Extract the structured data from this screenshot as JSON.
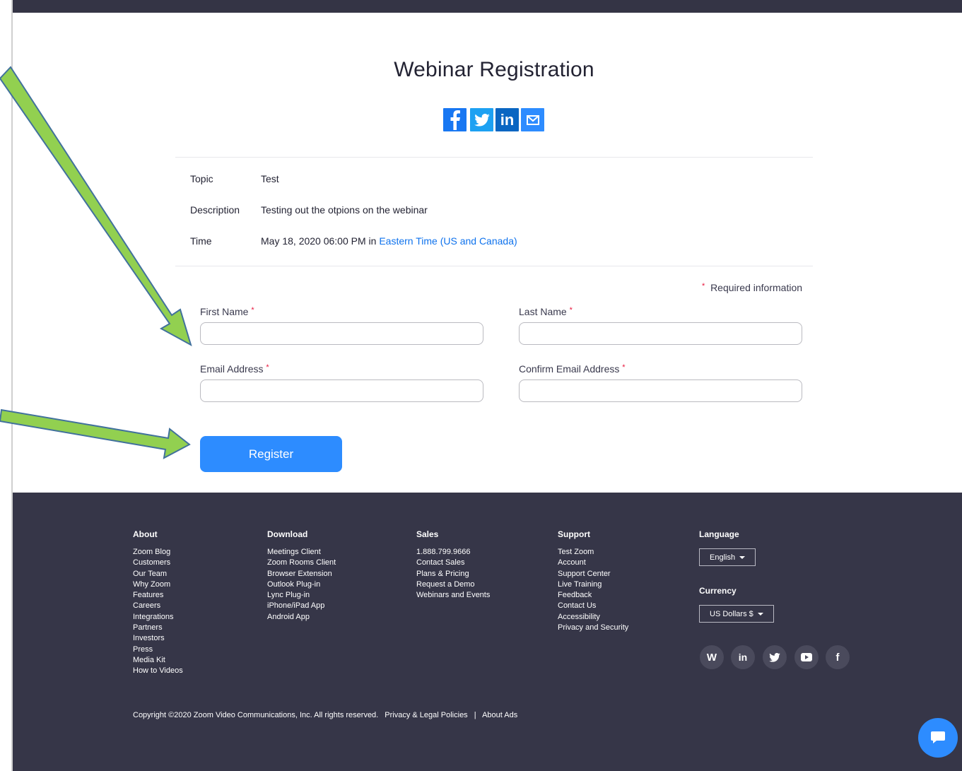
{
  "page": {
    "title": "Webinar Registration"
  },
  "share_icons": [
    "facebook-icon",
    "twitter-icon",
    "linkedin-icon",
    "email-icon"
  ],
  "info": {
    "topic_label": "Topic",
    "topic_value": "Test",
    "description_label": "Description",
    "description_value": "Testing out the otpions on the webinar",
    "time_label": "Time",
    "time_value": "May 18, 2020 06:00 PM in",
    "time_zone": "Eastern Time (US and Canada)"
  },
  "form": {
    "required_star": "*",
    "required_note": "Required information",
    "first_name_label": "First Name",
    "last_name_label": "Last Name",
    "email_label": "Email Address",
    "confirm_email_label": "Confirm Email Address",
    "first_name_value": "",
    "last_name_value": "",
    "email_value": "",
    "confirm_email_value": "",
    "register_label": "Register"
  },
  "footer": {
    "about": {
      "heading": "About",
      "links": [
        "Zoom Blog",
        "Customers",
        "Our Team",
        "Why Zoom",
        "Features",
        "Careers",
        "Integrations",
        "Partners",
        "Investors",
        "Press",
        "Media Kit",
        "How to Videos"
      ]
    },
    "download": {
      "heading": "Download",
      "links": [
        "Meetings Client",
        "Zoom Rooms Client",
        "Browser Extension",
        "Outlook Plug-in",
        "Lync Plug-in",
        "iPhone/iPad App",
        "Android App"
      ]
    },
    "sales": {
      "heading": "Sales",
      "links": [
        "1.888.799.9666",
        "Contact Sales",
        "Plans & Pricing",
        "Request a Demo",
        "Webinars and Events"
      ]
    },
    "support": {
      "heading": "Support",
      "links": [
        "Test Zoom",
        "Account",
        "Support Center",
        "Live Training",
        "Feedback",
        "Contact Us",
        "Accessibility",
        "Privacy and Security"
      ]
    },
    "language": {
      "heading": "Language",
      "selected": "English"
    },
    "currency": {
      "heading": "Currency",
      "selected": "US Dollars $"
    },
    "social_icons": [
      "wordpress-icon",
      "linkedin-icon",
      "twitter-icon",
      "youtube-icon",
      "facebook-icon"
    ],
    "copyright": "Copyright ©2020 Zoom Video Communications, Inc. All rights reserved.",
    "privacy_link": "Privacy & Legal Policies",
    "separator": "|",
    "about_ads_link": "About Ads"
  },
  "colors": {
    "accent": "#2d8cff",
    "footer_bg": "#363648",
    "arrow_fill": "#92d050",
    "arrow_stroke": "#41719c",
    "required": "#e8173d"
  }
}
